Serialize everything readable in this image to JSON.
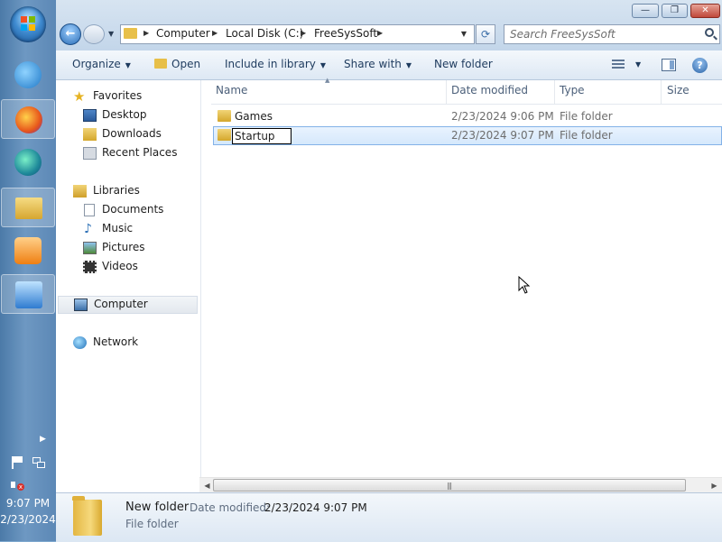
{
  "taskbar": {
    "apps": [
      {
        "name": "internet-explorer",
        "color": "#2a8ad6"
      },
      {
        "name": "firefox",
        "color": "#e8681f"
      },
      {
        "name": "edge-legacy",
        "color": "#2aa79c"
      },
      {
        "name": "windows-explorer",
        "color": "#e7bf48"
      },
      {
        "name": "media-player",
        "color": "#f08a1c"
      },
      {
        "name": "control-panel",
        "color": "#3b8bd8"
      }
    ],
    "clock": {
      "time": "9:07 PM",
      "date": "2/23/2024"
    }
  },
  "window": {
    "controls": {
      "minimize": "—",
      "maximize": "❐",
      "close": "✕"
    },
    "address": {
      "crumbs": [
        "Computer",
        "Local Disk (C:)",
        "FreeSysSoft"
      ]
    },
    "search": {
      "placeholder": "Search FreeSysSoft"
    },
    "toolbar": {
      "organize": "Organize",
      "open": "Open",
      "include_in_library": "Include in library",
      "share_with": "Share with",
      "new_folder": "New folder",
      "help": "?"
    },
    "navpane": {
      "favorites": "Favorites",
      "desktop": "Desktop",
      "downloads": "Downloads",
      "recent_places": "Recent Places",
      "libraries": "Libraries",
      "documents": "Documents",
      "music": "Music",
      "pictures": "Pictures",
      "videos": "Videos",
      "computer": "Computer",
      "network": "Network"
    },
    "columns": {
      "name": "Name",
      "date_modified": "Date modified",
      "type": "Type",
      "size": "Size"
    },
    "files": [
      {
        "name": "Games",
        "date": "2/23/2024 9:06 PM",
        "type": "File folder"
      },
      {
        "name": "Startup",
        "date": "2/23/2024 9:07 PM",
        "type": "File folder",
        "renaming": true
      }
    ],
    "details": {
      "name": "New folder",
      "date_label": "Date modified:",
      "date_value": "2/23/2024 9:07 PM",
      "type": "File folder"
    }
  }
}
